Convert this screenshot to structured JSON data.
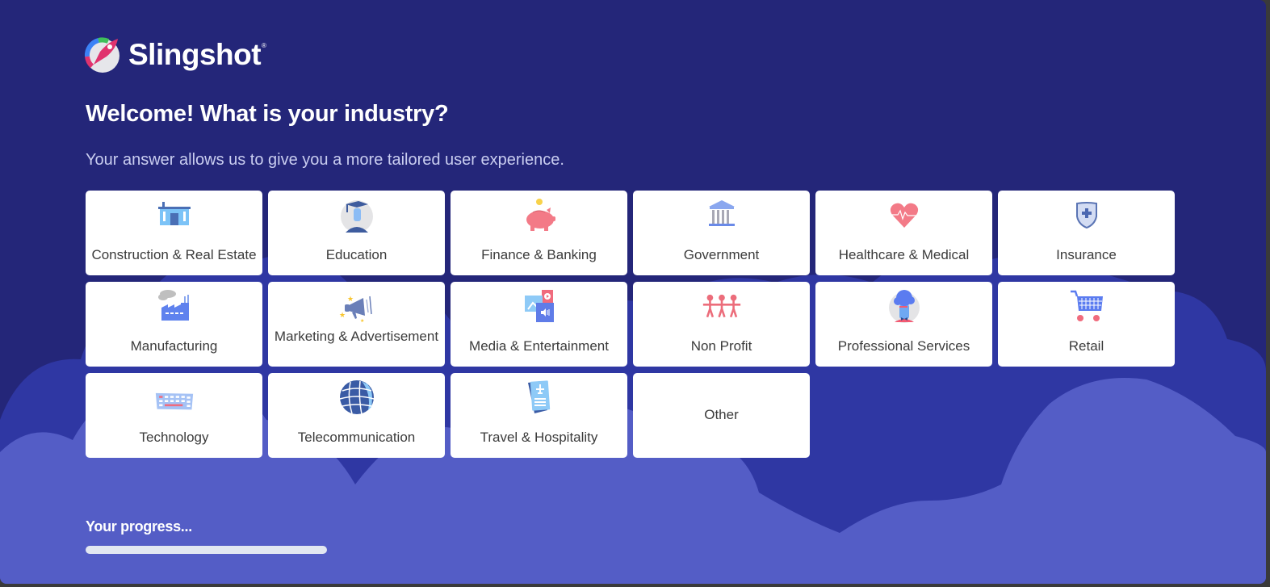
{
  "app": {
    "brand": "Slingshot",
    "brand_mark": "®"
  },
  "header": {
    "title": "Welcome! What is your industry?",
    "subtitle": "Your answer allows us to give you a more tailored user experience."
  },
  "industries": [
    {
      "label": "Construction & Real Estate",
      "icon": "building-icon"
    },
    {
      "label": "Education",
      "icon": "graduate-icon"
    },
    {
      "label": "Finance & Banking",
      "icon": "piggy-bank-icon"
    },
    {
      "label": "Government",
      "icon": "government-building-icon"
    },
    {
      "label": "Healthcare & Medical",
      "icon": "heartbeat-icon"
    },
    {
      "label": "Insurance",
      "icon": "shield-plus-icon"
    },
    {
      "label": "Manufacturing",
      "icon": "factory-icon"
    },
    {
      "label": "Marketing & Advertisement",
      "icon": "megaphone-icon"
    },
    {
      "label": "Media & Entertainment",
      "icon": "media-icon"
    },
    {
      "label": "Non Profit",
      "icon": "people-chain-icon"
    },
    {
      "label": "Professional Services",
      "icon": "professional-avatar-icon"
    },
    {
      "label": "Retail",
      "icon": "shopping-cart-icon"
    },
    {
      "label": "Technology",
      "icon": "keyboard-icon"
    },
    {
      "label": "Telecommunication",
      "icon": "globe-icon"
    },
    {
      "label": "Travel & Hospitality",
      "icon": "boarding-pass-icon"
    },
    {
      "label": "Other",
      "icon": null
    }
  ],
  "progress": {
    "label": "Your progress...",
    "percent": 0
  },
  "colors": {
    "background": "#242679",
    "cloud_mid": "#2f37a3",
    "cloud_front": "#545dc6",
    "card": "#ffffff",
    "progress_track": "#e2e7f1",
    "accent_pink": "#f0737f",
    "accent_blue": "#5b7cf0"
  }
}
